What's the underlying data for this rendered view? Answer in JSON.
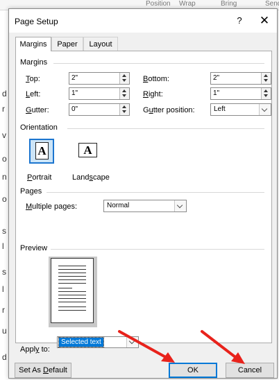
{
  "background": {
    "ribbon_items": [
      "Position",
      "Wrap",
      "Bring",
      "Send"
    ],
    "letters": [
      "d",
      "r",
      "v",
      "o",
      "n",
      "o",
      "s",
      "l",
      "s",
      "l",
      "r",
      "u",
      "d"
    ]
  },
  "dialog": {
    "title": "Page Setup",
    "help": "?",
    "close": "✕",
    "tabs": [
      {
        "label": "Margins",
        "active": true
      },
      {
        "label": "Paper",
        "active": false
      },
      {
        "label": "Layout",
        "active": false
      }
    ],
    "margins": {
      "section": "Margins",
      "top": {
        "label_u": "T",
        "label_rest": "op:",
        "value": "2\""
      },
      "left": {
        "label_u": "L",
        "label_rest": "eft:",
        "value": "1\""
      },
      "gutter": {
        "label_u": "G",
        "label_rest": "utter:",
        "value": "0\""
      },
      "bottom": {
        "label_u": "B",
        "label_rest": "ottom:",
        "value": "2\""
      },
      "right": {
        "label_u": "R",
        "label_rest": "ight:",
        "value": "1\""
      },
      "gutter_pos": {
        "label_pre": "G",
        "label_u": "u",
        "label_rest": "tter position:",
        "value": "Left"
      }
    },
    "orientation": {
      "section": "Orientation",
      "portrait": {
        "label_u": "P",
        "label_rest": "ortrait",
        "glyph": "A"
      },
      "landscape": {
        "label_pre": "Land",
        "label_u": "s",
        "label_rest": "cape",
        "glyph": "A"
      }
    },
    "pages": {
      "section": "Pages",
      "multiple_label_u": "M",
      "multiple_label_rest": "ultiple pages:",
      "multiple_value": "Normal"
    },
    "preview": {
      "section": "Preview"
    },
    "apply": {
      "label_pre": "Appl",
      "label_u": "y",
      "label_rest": " to:",
      "value": "Selected text"
    },
    "buttons": {
      "set_default_pre": "Set As ",
      "set_default_u": "D",
      "set_default_rest": "efault",
      "ok": "OK",
      "cancel": "Cancel"
    }
  },
  "colors": {
    "accent": "#0078d7",
    "annotation_arrow": "#e8221b"
  }
}
